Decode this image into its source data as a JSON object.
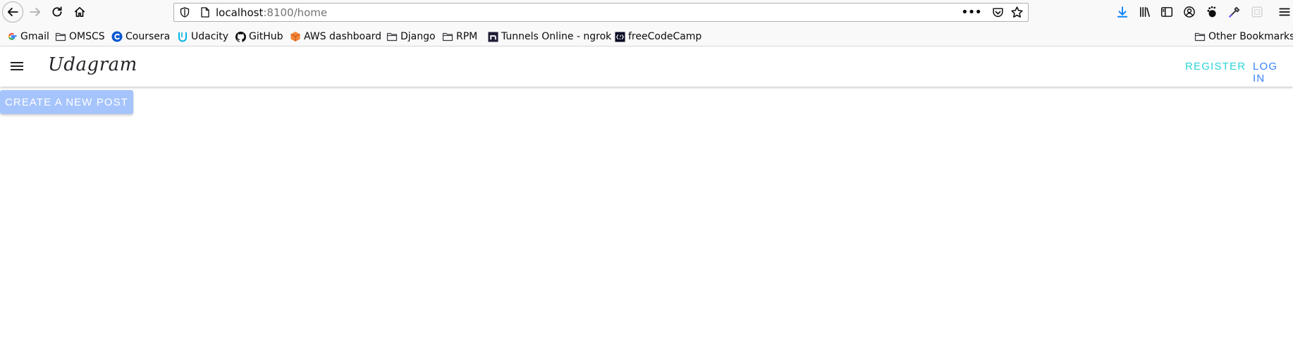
{
  "browser": {
    "url_host": "localhost",
    "url_path": ":8100/home",
    "more_label": "•••"
  },
  "bookmarks": [
    {
      "label": "Gmail",
      "icon": "google-icon"
    },
    {
      "label": "OMSCS",
      "icon": "folder-icon"
    },
    {
      "label": "Coursera",
      "icon": "coursera-icon"
    },
    {
      "label": "Udacity",
      "icon": "udacity-icon"
    },
    {
      "label": "GitHub",
      "icon": "github-icon"
    },
    {
      "label": "AWS dashboard",
      "icon": "aws-icon"
    },
    {
      "label": "Django",
      "icon": "folder-icon"
    },
    {
      "label": "RPM",
      "icon": "folder-icon"
    },
    {
      "label": "Tunnels Online - ngrok",
      "icon": "ngrok-icon"
    },
    {
      "label": "freeCodeCamp",
      "icon": "freecodecamp-icon"
    }
  ],
  "other_bookmarks": "Other Bookmarks",
  "app": {
    "title": "Udagram",
    "register_label": "REGISTER",
    "login_label": "LOG IN",
    "create_post_label": "CREATE A NEW POST"
  },
  "colors": {
    "register": "#2dd3d6",
    "login": "#3880ff",
    "create_button_bg": "#a6c4fc",
    "download_icon": "#0a84ff"
  }
}
